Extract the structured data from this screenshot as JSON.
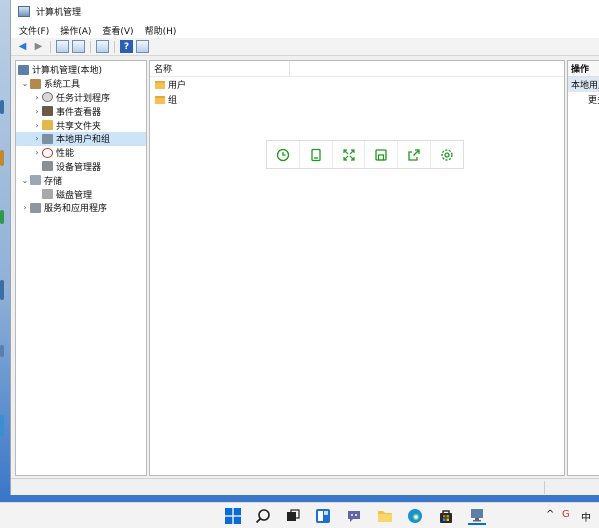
{
  "window": {
    "title": "计算机管理"
  },
  "menubar": {
    "items": [
      "文件(F)",
      "操作(A)",
      "查看(V)",
      "帮助(H)"
    ]
  },
  "toolbar": {
    "help_glyph": "?"
  },
  "tree": {
    "root": "计算机管理(本地)",
    "system_tools": "系统工具",
    "task_scheduler": "任务计划程序",
    "event_viewer": "事件查看器",
    "shared_folders": "共享文件夹",
    "local_users": "本地用户和组",
    "performance": "性能",
    "device_manager": "设备管理器",
    "storage": "存储",
    "disk_management": "磁盘管理",
    "services_apps": "服务和应用程序"
  },
  "content": {
    "column_name": "名称",
    "items": [
      "用户",
      "组"
    ]
  },
  "actions": {
    "header": "操作",
    "item": "本地用户和组",
    "sub": "更多操作"
  },
  "taskbar": {
    "ime": "中"
  },
  "colors": {
    "accent": "#1a9a1a",
    "selection": "#cce4f7",
    "start_blue": "#0a6cd6"
  }
}
